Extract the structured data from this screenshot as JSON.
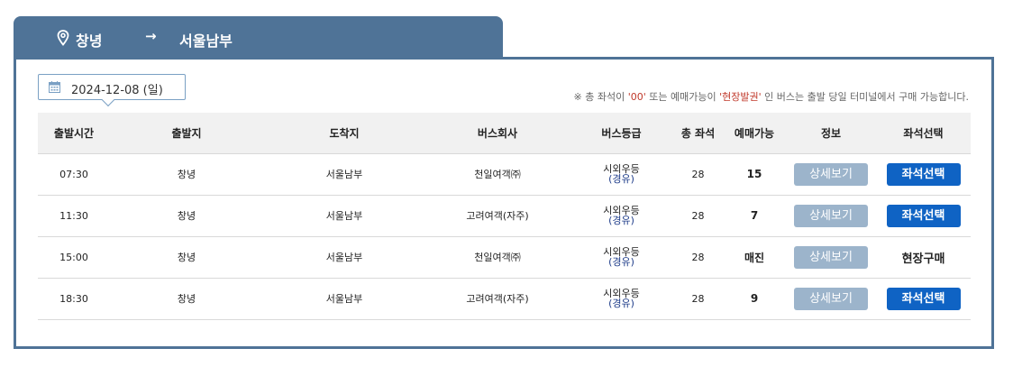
{
  "route": {
    "from": "창녕",
    "arrow": "→",
    "to": "서울남부"
  },
  "date": {
    "label": "2024-12-08 (일)"
  },
  "notice": {
    "prefix": "※ 총 좌석이 ",
    "seats_hl": "'00'",
    "mid": " 또는 예매가능이 ",
    "onsite_hl": "'현장발권'",
    "suffix": " 인 버스는 출발 당일 터미널에서 구매 가능합니다."
  },
  "table": {
    "headers": [
      "출발시간",
      "출발지",
      "도착지",
      "버스회사",
      "버스등급",
      "총 좌석",
      "예매가능",
      "정보",
      "좌석선택"
    ],
    "rows": [
      {
        "time": "07:30",
        "origin": "창녕",
        "dest": "서울남부",
        "company": "천일여객㈜",
        "grade": "시외우등",
        "grade_sub": "(경유)",
        "total": "28",
        "available": "15",
        "info": "상세보기",
        "select": "좌석선택",
        "select_type": "button"
      },
      {
        "time": "11:30",
        "origin": "창녕",
        "dest": "서울남부",
        "company": "고려여객(자주)",
        "grade": "시외우등",
        "grade_sub": "(경유)",
        "total": "28",
        "available": "7",
        "info": "상세보기",
        "select": "좌석선택",
        "select_type": "button"
      },
      {
        "time": "15:00",
        "origin": "창녕",
        "dest": "서울남부",
        "company": "천일여객㈜",
        "grade": "시외우등",
        "grade_sub": "(경유)",
        "total": "28",
        "available": "매진",
        "info": "상세보기",
        "select": "현장구매",
        "select_type": "text"
      },
      {
        "time": "18:30",
        "origin": "창녕",
        "dest": "서울남부",
        "company": "고려여객(자주)",
        "grade": "시외우등",
        "grade_sub": "(경유)",
        "total": "28",
        "available": "9",
        "info": "상세보기",
        "select": "좌석선택",
        "select_type": "button"
      }
    ]
  },
  "icons": {
    "pin": "map-pin-icon",
    "calendar": "calendar-icon"
  },
  "colors": {
    "header_blue": "#4f7397",
    "seat_button": "#0f63c4",
    "detail_button": "#9cb4cb",
    "notice_highlight": "#c0392b"
  }
}
